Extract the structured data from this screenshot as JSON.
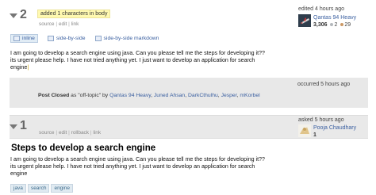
{
  "rev2": {
    "number": "2",
    "comment": "added 1 characters in body",
    "links": [
      "source",
      "edit",
      "link"
    ],
    "edited_label": "edited 4 hours ago",
    "user_name": "Qantas 94 Heavy",
    "rep": "3,306",
    "silver_count": "2",
    "silver_color": "#b4b8bc",
    "bronze_count": "29",
    "bronze_color": "#cc9966",
    "tabs": [
      "inline",
      "side-by-side",
      "side-by-side markdown"
    ],
    "body_lines": [
      "I am going to develop a search engine using java. Can you please tell me the steps for developing it??",
      "its urgent please help. I have not tried anything yet. I just want to develop an application for search",
      "engine"
    ]
  },
  "closed": {
    "occurred_label": "occurred 5 hours ago",
    "action": "Post Closed",
    "reason_prefix": "as",
    "reason": "\"off-topic\"",
    "by_label": "by",
    "users": [
      "Qantas 94 Heavy",
      "Juned Ahsan",
      "DarkCthulhu",
      "Jesper",
      "mKorbel"
    ]
  },
  "rev1": {
    "number": "1",
    "links": [
      "source",
      "edit",
      "rollback",
      "link"
    ],
    "asked_label": "asked 5 hours ago",
    "user_name": "Pooja Chaudhary",
    "rep": "1",
    "title": "Steps to develop a search engine",
    "body_lines": [
      "I am going to develop a search engine using java. Can you please tell me the steps for developing it??",
      "its urgent please help. I have not tried anything yet. I just want to develop an application for search",
      "engine"
    ],
    "tags": [
      "java",
      "search",
      "engine"
    ]
  }
}
